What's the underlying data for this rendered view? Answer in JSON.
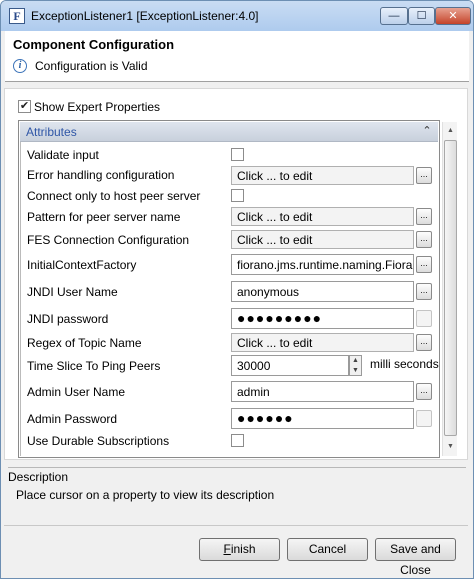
{
  "window": {
    "title": "ExceptionListener1 [ExceptionListener:4.0]",
    "app_icon_letter": "F",
    "min_symbol": "—",
    "max_symbol": "☐",
    "close_symbol": "✕"
  },
  "header": {
    "title": "Component Configuration",
    "message": "Configuration is Valid",
    "info_icon": "i"
  },
  "expert": {
    "label": "Show Expert Properties",
    "checked_mark": "✔"
  },
  "attributes": {
    "title": "Attributes",
    "collapse_icon": "⌃",
    "rows": [
      {
        "label": "Validate input"
      },
      {
        "label": "Error handling configuration",
        "value": "Click ... to edit"
      },
      {
        "label": "Connect only to host peer server"
      },
      {
        "label": "Pattern for peer server name",
        "value": "Click ... to edit"
      },
      {
        "label": "FES Connection Configuration",
        "value": "Click ... to edit"
      },
      {
        "label": "InitialContextFactory",
        "value": "fiorano.jms.runtime.naming.FioranoInitialContextFactory"
      },
      {
        "label": "JNDI User Name",
        "value": "anonymous"
      },
      {
        "label": "JNDI password",
        "value": "●●●●●●●●●"
      },
      {
        "label": "Regex of Topic Name",
        "value": "Click ... to edit"
      },
      {
        "label": "Time Slice To Ping Peers",
        "value": "30000",
        "unit": "milli seconds"
      },
      {
        "label": "Admin User Name",
        "value": "admin"
      },
      {
        "label": "Admin Password",
        "value": "●●●●●●"
      },
      {
        "label": "Use Durable Subscriptions"
      }
    ],
    "dots_label": "...",
    "spin_up": "▲",
    "spin_down": "▼"
  },
  "scrollbar": {
    "up": "▲",
    "down": "▼"
  },
  "description": {
    "title": "Description",
    "text": "Place cursor on a property to view its description"
  },
  "buttons": {
    "finish_prefix": "",
    "finish_mnemonic": "F",
    "finish_rest": "inish",
    "cancel": "Cancel",
    "save_close": "Save and Close"
  }
}
